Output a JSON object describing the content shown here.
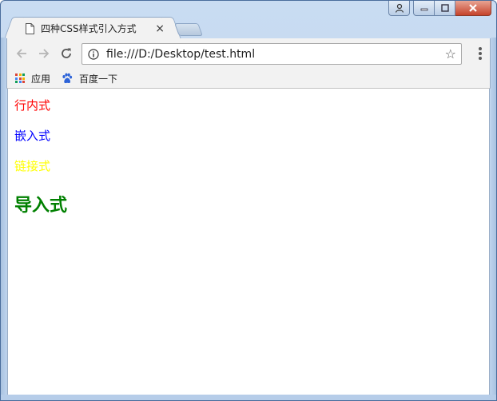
{
  "window": {
    "tab_title": "四种CSS样式引入方式",
    "tab_close": "×"
  },
  "toolbar": {
    "url": "file:///D:/Desktop/test.html"
  },
  "bookmarks": [
    {
      "label": "应用",
      "icon": "apps-grid-icon"
    },
    {
      "label": "百度一下",
      "icon": "baidu-paw-icon"
    }
  ],
  "content": {
    "inline": {
      "text": "行内式",
      "color": "#ff0000"
    },
    "embedded": {
      "text": "嵌入式",
      "color": "#0000ff"
    },
    "linked": {
      "text": "链接式",
      "color": "#ffff00"
    },
    "imported": {
      "text": "导入式",
      "color": "#008000"
    }
  }
}
